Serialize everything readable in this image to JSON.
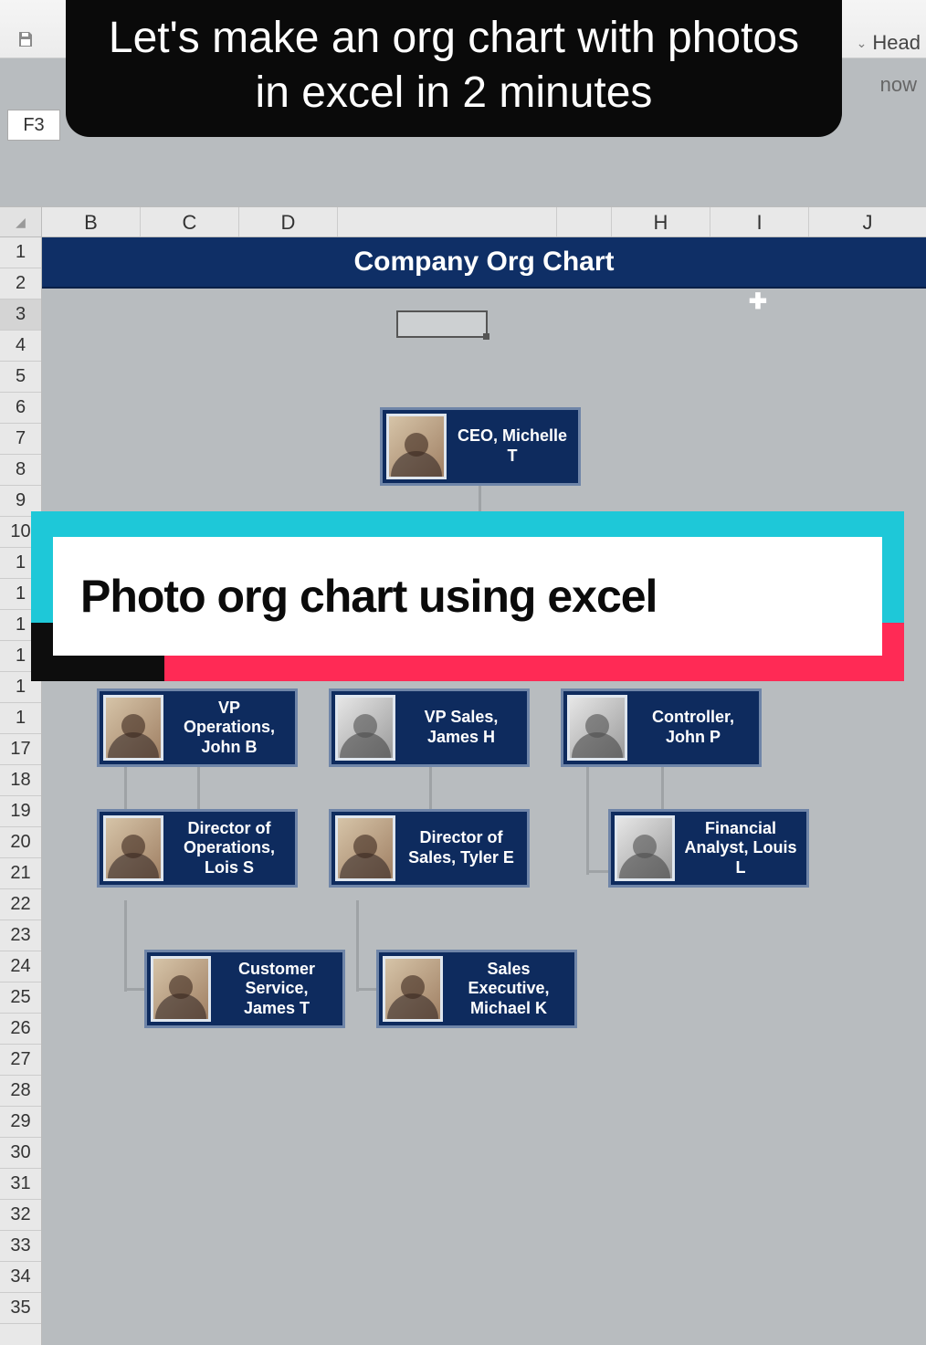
{
  "overlay": {
    "caption": "Let's make an org chart with photos in excel in 2 minutes",
    "panel_title": "Photo org chart using excel"
  },
  "ribbon": {
    "head_label": "Head",
    "now_label": "now"
  },
  "namebox": {
    "value": "F3"
  },
  "columns": [
    "B",
    "C",
    "D",
    "",
    "",
    "H",
    "I",
    "J"
  ],
  "rows": [
    "1",
    "2",
    "3",
    "4",
    "5",
    "6",
    "7",
    "8",
    "9",
    "10",
    "1",
    "1",
    "1",
    "1",
    "1",
    "1",
    "17",
    "18",
    "19",
    "20",
    "21",
    "22",
    "23",
    "24",
    "25",
    "26",
    "27",
    "28",
    "29",
    "30",
    "31",
    "32",
    "33",
    "34",
    "35"
  ],
  "sheet": {
    "title": "Company Org Chart"
  },
  "org": {
    "ceo": {
      "label": "CEO, Michelle T"
    },
    "vp_ops": {
      "label": "VP Operations, John B"
    },
    "vp_sales": {
      "label": "VP Sales, James H"
    },
    "controller": {
      "label": "Controller, John P"
    },
    "dir_ops": {
      "label": "Director of Operations, Lois S"
    },
    "dir_sales": {
      "label": "Director of Sales, Tyler E"
    },
    "fin_analyst": {
      "label": "Financial Analyst, Louis L"
    },
    "cust_svc": {
      "label": "Customer Service, James T"
    },
    "sales_exec": {
      "label": "Sales Executive, Michael K"
    }
  },
  "chart_data": {
    "type": "org",
    "title": "Company Org Chart",
    "nodes": [
      {
        "id": "ceo",
        "role": "CEO",
        "name": "Michelle T",
        "parent": null
      },
      {
        "id": "vp_ops",
        "role": "VP Operations",
        "name": "John B",
        "parent": "ceo"
      },
      {
        "id": "vp_sales",
        "role": "VP Sales",
        "name": "James H",
        "parent": "ceo"
      },
      {
        "id": "controller",
        "role": "Controller",
        "name": "John P",
        "parent": "ceo"
      },
      {
        "id": "dir_ops",
        "role": "Director of Operations",
        "name": "Lois S",
        "parent": "vp_ops"
      },
      {
        "id": "dir_sales",
        "role": "Director of Sales",
        "name": "Tyler E",
        "parent": "vp_sales"
      },
      {
        "id": "fin_analyst",
        "role": "Financial Analyst",
        "name": "Louis L",
        "parent": "controller"
      },
      {
        "id": "cust_svc",
        "role": "Customer Service",
        "name": "James T",
        "parent": "dir_ops"
      },
      {
        "id": "sales_exec",
        "role": "Sales Executive",
        "name": "Michael K",
        "parent": "dir_sales"
      }
    ]
  }
}
